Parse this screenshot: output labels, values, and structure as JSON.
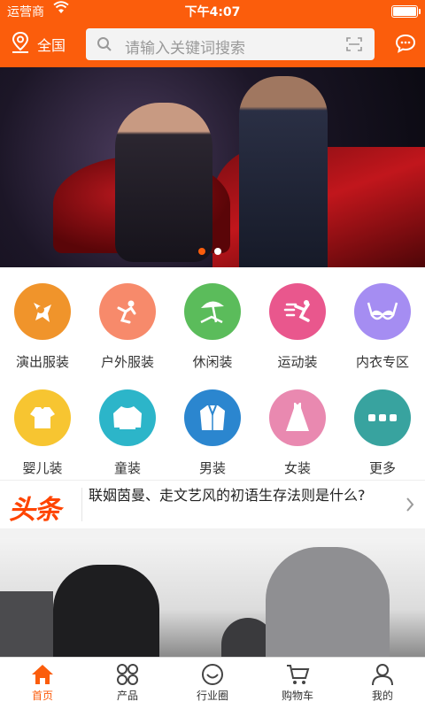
{
  "status_bar": {
    "carrier": "运营商",
    "time": "下午4:07"
  },
  "header": {
    "location": "全国",
    "search_placeholder": "请输入关键词搜索"
  },
  "banner": {
    "slides": 2,
    "active_slide": 1
  },
  "categories": [
    {
      "label": "演出服装",
      "color": "#f0942b",
      "icon": "performance-icon"
    },
    {
      "label": "户外服装",
      "color": "#f78a6b",
      "icon": "outdoor-icon"
    },
    {
      "label": "休闲装",
      "color": "#5bbc5b",
      "icon": "beach-umbrella-icon"
    },
    {
      "label": "运动装",
      "color": "#e9578d",
      "icon": "runner-icon"
    },
    {
      "label": "内衣专区",
      "color": "#a58df2",
      "icon": "bra-icon"
    },
    {
      "label": "婴儿装",
      "color": "#f7c531",
      "icon": "baby-clothes-icon"
    },
    {
      "label": "童装",
      "color": "#2cb5c9",
      "icon": "sweater-icon"
    },
    {
      "label": "男装",
      "color": "#2b86cf",
      "icon": "suit-icon"
    },
    {
      "label": "女装",
      "color": "#e989b0",
      "icon": "dress-icon"
    },
    {
      "label": "更多",
      "color": "#38a39f",
      "icon": "more-icon"
    }
  ],
  "headline": {
    "logo": "头条",
    "text": "联姻茵曼、走文艺风的初语生存法则是什么?"
  },
  "tabbar": [
    {
      "label": "首页",
      "icon": "home-icon",
      "active": true
    },
    {
      "label": "产品",
      "icon": "grid-icon",
      "active": false
    },
    {
      "label": "行业圈",
      "icon": "smile-icon",
      "active": false
    },
    {
      "label": "购物车",
      "icon": "cart-icon",
      "active": false
    },
    {
      "label": "我的",
      "icon": "user-icon",
      "active": false
    }
  ],
  "colors": {
    "brand": "#fb5d0c",
    "headline_logo": "#ff4400"
  }
}
